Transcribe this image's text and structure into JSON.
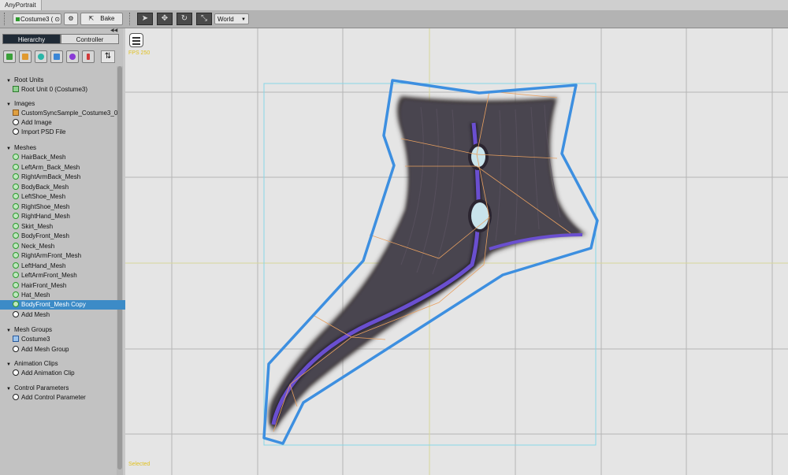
{
  "title": "AnyPortrait",
  "toolbar": {
    "portrait_dropdown": "Costume3 (",
    "bake_label": "Bake",
    "space_dropdown": "World"
  },
  "tabs": [
    "Hierarchy",
    "Controller"
  ],
  "sections": {
    "root_units": {
      "label": "Root Units",
      "items": [
        "Root Unit 0 (Costume3)"
      ]
    },
    "images": {
      "label": "Images",
      "items": [
        "CustomSyncSample_Costume3_0"
      ],
      "add_label": "Add Image",
      "import_label": "Import PSD File"
    },
    "meshes": {
      "label": "Meshes",
      "items": [
        "HairBack_Mesh",
        "LeftArm_Back_Mesh",
        "RightArmBack_Mesh",
        "BodyBack_Mesh",
        "LeftShoe_Mesh",
        "RightShoe_Mesh",
        "RightHand_Mesh",
        "Skirt_Mesh",
        "BodyFront_Mesh",
        "Neck_Mesh",
        "RightArmFront_Mesh",
        "LeftHand_Mesh",
        "LeftArmFront_Mesh",
        "HairFront_Mesh",
        "Hat_Mesh",
        "BodyFront_Mesh Copy"
      ],
      "selected": "BodyFront_Mesh Copy",
      "add_label": "Add Mesh"
    },
    "mesh_groups": {
      "label": "Mesh Groups",
      "items": [
        "Costume3"
      ],
      "add_label": "Add Mesh Group"
    },
    "animation_clips": {
      "label": "Animation Clips",
      "add_label": "Add Animation Clip"
    },
    "control_parameters": {
      "label": "Control Parameters",
      "add_label": "Add Control Parameter"
    }
  },
  "viewport": {
    "fps_text": "FPS 250",
    "status_text": "Selected"
  },
  "colors": {
    "selected_row": "#3c8bc7",
    "outline": "#3d8fe0",
    "mesh_fill": "#4a4450",
    "accent_strip": "#6a4fd0"
  }
}
